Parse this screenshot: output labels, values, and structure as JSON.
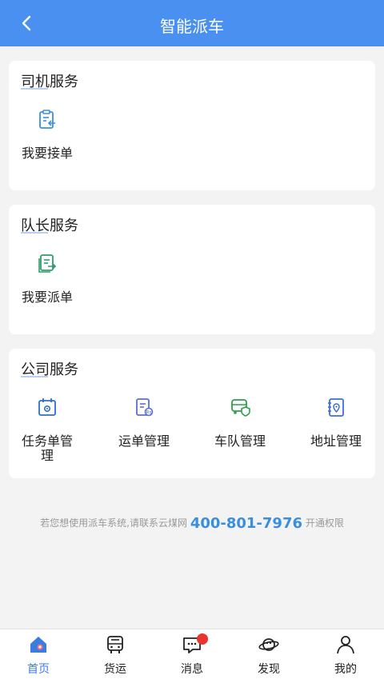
{
  "header": {
    "title": "智能派车",
    "back_icon": "chevron-left-icon"
  },
  "driver": {
    "title": "司机服务",
    "items": [
      {
        "label": "我要接单",
        "icon": "clipboard-receive-icon",
        "color": "#3a8ee0"
      }
    ]
  },
  "captain": {
    "title": "队长服务",
    "items": [
      {
        "label": "我要派单",
        "icon": "document-dispatch-icon",
        "color": "#2e9e6a"
      }
    ]
  },
  "company": {
    "title": "公司服务",
    "items": [
      {
        "label": "任务单管",
        "label2": "理",
        "icon": "calendar-gear-icon",
        "color": "#2d6fcf"
      },
      {
        "label": "运单管理",
        "icon": "waybill-icon",
        "color": "#5b6fd6"
      },
      {
        "label": "车队管理",
        "icon": "truck-shield-icon",
        "color": "#2e9e4a"
      },
      {
        "label": "地址管理",
        "icon": "address-book-icon",
        "color": "#3f6fd6"
      }
    ]
  },
  "notice": {
    "prefix": "若您想使用派车系统,请联系云煤网",
    "phone": "400-801-7976",
    "suffix": "开通权限"
  },
  "tabbar": {
    "items": [
      {
        "label": "首页",
        "icon": "home-icon",
        "active": true
      },
      {
        "label": "货运",
        "icon": "bus-icon"
      },
      {
        "label": "消息",
        "icon": "message-icon",
        "badge": true
      },
      {
        "label": "发现",
        "icon": "planet-icon"
      },
      {
        "label": "我的",
        "icon": "user-icon"
      }
    ]
  },
  "colors": {
    "header": "#4a90f0",
    "active_tab": "#3a7de0",
    "badge": "#e8352d",
    "phone": "#3a8ee0"
  }
}
